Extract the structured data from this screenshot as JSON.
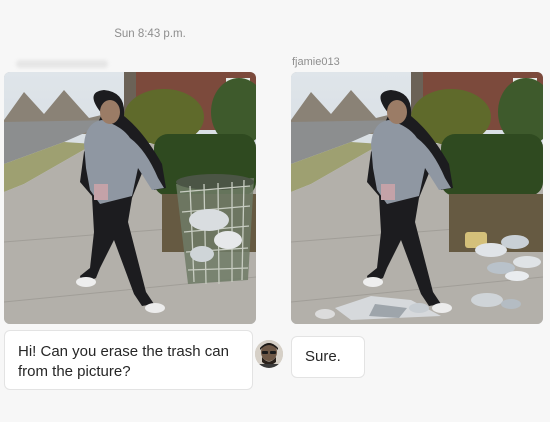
{
  "timestamp": "Sun 8:43 p.m.",
  "photo_reply": {
    "username": "fjamie013"
  },
  "messages": [
    {
      "sender": "requester",
      "text": "Hi! Can you erase the trash can from the picture?"
    },
    {
      "sender": "fjamie013",
      "text": "Sure."
    }
  ],
  "icons": {
    "avatar": "profile-avatar-icon"
  }
}
